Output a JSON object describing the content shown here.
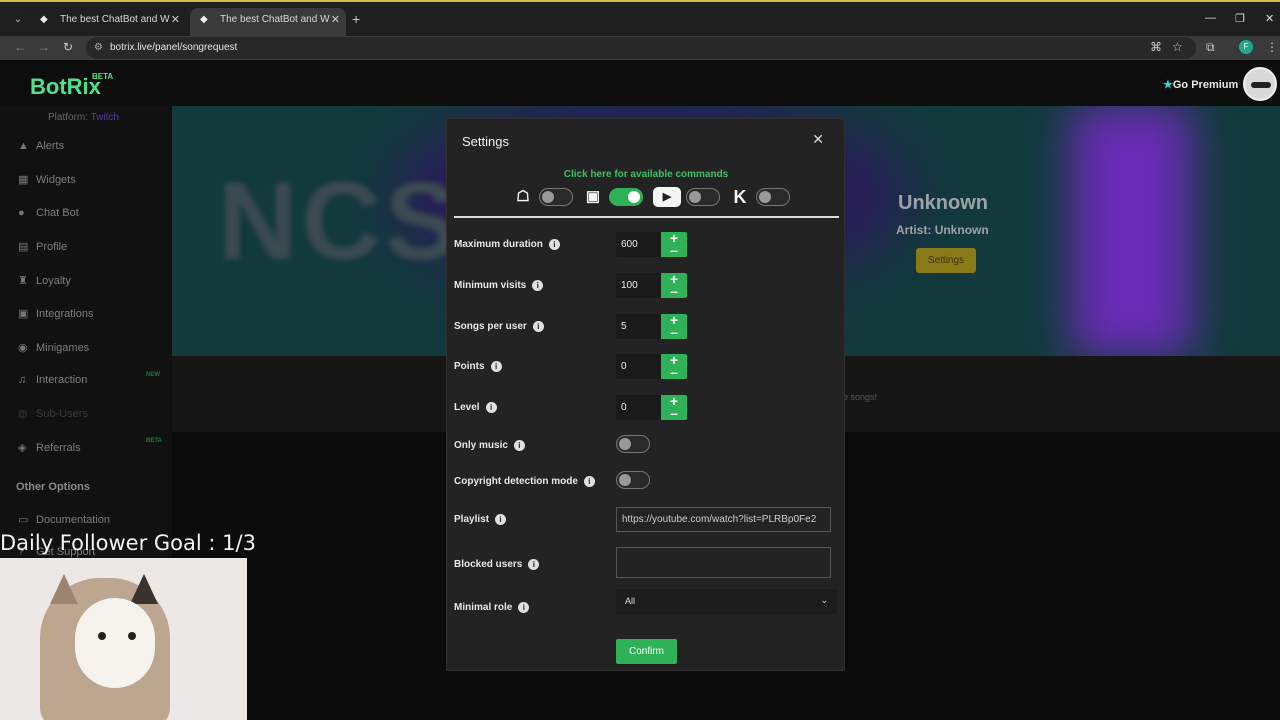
{
  "browser": {
    "tabs": [
      {
        "title": "The best ChatBot and Widgets",
        "active": false
      },
      {
        "title": "The best ChatBot and Widgets",
        "active": true
      }
    ],
    "url": "botrix.live/panel/songrequest",
    "profile_initial": "F"
  },
  "app": {
    "logo": "BotRix",
    "logo_badge": "BETA",
    "premium_label": "Go Premium",
    "platform_label": "Platform:",
    "platform_value": "Twitch"
  },
  "sidebar": {
    "items": [
      {
        "label": "Alerts",
        "icon": "warning-icon"
      },
      {
        "label": "Widgets",
        "icon": "grid-icon"
      },
      {
        "label": "Chat Bot",
        "icon": "robot-icon"
      },
      {
        "label": "Profile",
        "icon": "id-card-icon"
      },
      {
        "label": "Loyalty",
        "icon": "trophy-icon"
      },
      {
        "label": "Integrations",
        "icon": "integrations-icon"
      },
      {
        "label": "Minigames",
        "icon": "gamepad-icon"
      },
      {
        "label": "Interaction",
        "icon": "music-icon",
        "badge": "NEW"
      },
      {
        "label": "Sub-Users",
        "icon": "users-icon",
        "disabled": true
      },
      {
        "label": "Referrals",
        "icon": "referrals-icon",
        "badge": "BETA"
      }
    ],
    "other_options": "Other Options",
    "documentation": "Documentation",
    "support": "Get Support"
  },
  "song_panel": {
    "banner_text": "NCS",
    "title": "Unknown",
    "artist_label": "Artist:",
    "artist_value": "Unknown",
    "settings_button": "Settings",
    "songs_text": "e songs!"
  },
  "overlay": {
    "goal_text": "Daily Follower Goal : 1/3"
  },
  "modal": {
    "title": "Settings",
    "commands_link": "Click here for available commands",
    "platform_toggles": [
      {
        "name": "kick-alt",
        "enabled": false
      },
      {
        "name": "twitch",
        "enabled": true
      },
      {
        "name": "youtube",
        "enabled": false
      },
      {
        "name": "kick",
        "enabled": false
      }
    ],
    "fields": {
      "max_duration": {
        "label": "Maximum duration",
        "value": "600"
      },
      "min_visits": {
        "label": "Minimum visits",
        "value": "100"
      },
      "songs_per_user": {
        "label": "Songs per user",
        "value": "5"
      },
      "points": {
        "label": "Points",
        "value": "0"
      },
      "level": {
        "label": "Level",
        "value": "0"
      },
      "only_music": {
        "label": "Only music",
        "enabled": false
      },
      "copyright": {
        "label": "Copyright detection mode",
        "enabled": false
      },
      "playlist": {
        "label": "Playlist",
        "value": "https://youtube.com/watch?list=PLRBp0Fe2"
      },
      "blocked_users": {
        "label": "Blocked users",
        "value": ""
      },
      "minimal_role": {
        "label": "Minimal role",
        "value": "All"
      }
    },
    "confirm_label": "Confirm"
  },
  "colors": {
    "accent": "#2fb158",
    "logo": "#4ee28a"
  }
}
